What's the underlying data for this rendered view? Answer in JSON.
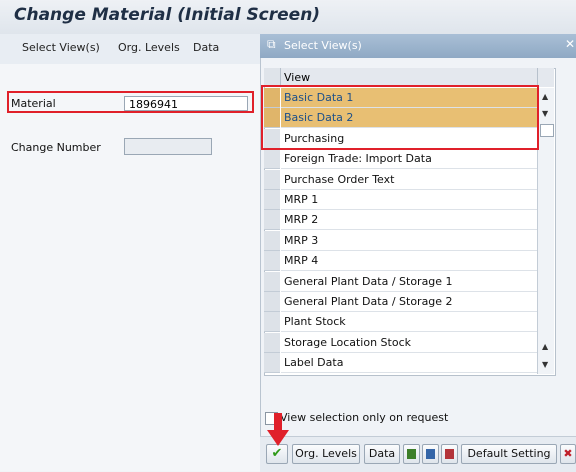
{
  "title": "Change Material (Initial Screen)",
  "menu": {
    "items": [
      "Select View(s)",
      "Org. Levels",
      "Data"
    ]
  },
  "form": {
    "material_label": "Material",
    "material_value": "1896941",
    "change_number_label": "Change Number",
    "change_number_value": ""
  },
  "dialog": {
    "title": "Select View(s)",
    "column_header": "View",
    "views": [
      {
        "label": "Basic Data 1",
        "selected": true
      },
      {
        "label": "Basic Data 2",
        "selected": true
      },
      {
        "label": "Purchasing",
        "selected": false
      },
      {
        "label": "Foreign Trade: Import Data",
        "selected": false
      },
      {
        "label": "Purchase Order Text",
        "selected": false
      },
      {
        "label": "MRP 1",
        "selected": false
      },
      {
        "label": "MRP 2",
        "selected": false
      },
      {
        "label": "MRP 3",
        "selected": false
      },
      {
        "label": "MRP 4",
        "selected": false
      },
      {
        "label": "General Plant Data / Storage 1",
        "selected": false
      },
      {
        "label": "General Plant Data / Storage 2",
        "selected": false
      },
      {
        "label": "Plant Stock",
        "selected": false
      },
      {
        "label": "Storage Location Stock",
        "selected": false
      },
      {
        "label": "Label Data",
        "selected": false
      }
    ],
    "view_on_request_label": "View selection only on request",
    "buttons": {
      "org_levels": "Org. Levels",
      "data": "Data",
      "default_setting": "Default Setting"
    }
  },
  "colors": {
    "selected_row": "#e8bf73",
    "highlight": "#e0202a"
  }
}
